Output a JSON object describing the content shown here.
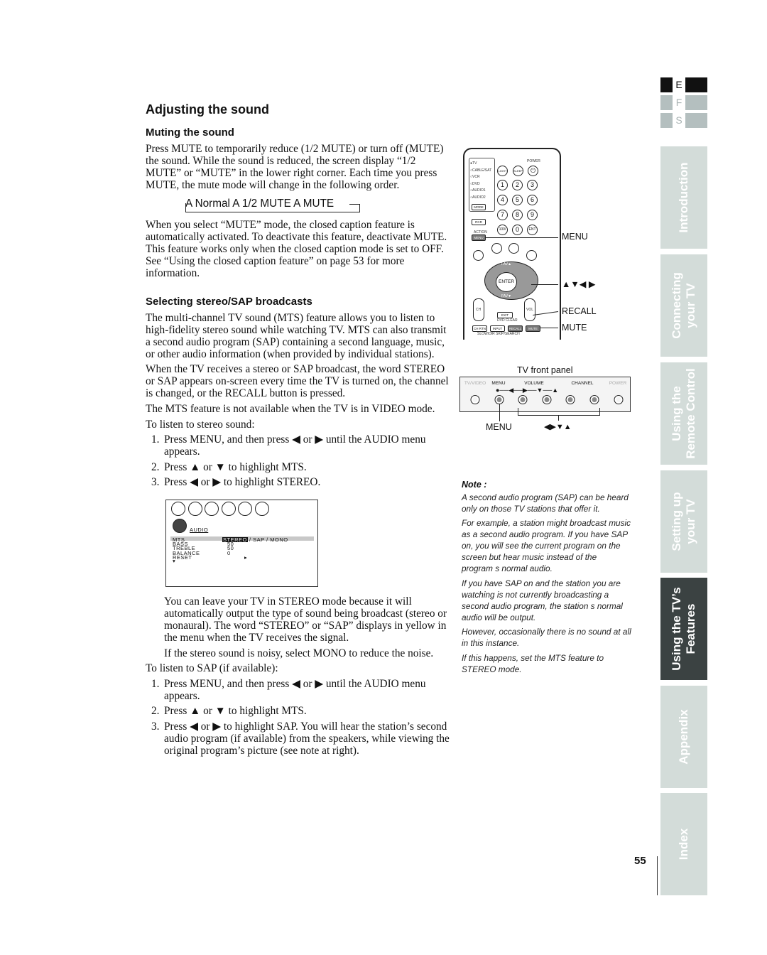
{
  "title": "Adjusting the sound",
  "muting": {
    "heading": "Muting the sound",
    "p1": [
      "Press MUTE to temporarily reduce (1/2 MUTE) or turn off (MUTE)",
      "the sound. While the sound is reduced, the screen display “1/2",
      "MUTE” or “MUTE” in the lower right corner. Each time you press",
      "MUTE, the mute mode will change in the following order."
    ],
    "sequence": "A Normal  A 1/2 MUTE  A MUTE",
    "p2": [
      "When you select “MUTE” mode, the closed caption feature is",
      "automatically activated. To deactivate this feature, deactivate MUTE.",
      "This feature works only when the closed caption mode is set to OFF.",
      "See “Using the closed caption feature” on page 53 for more",
      "information."
    ]
  },
  "stereo": {
    "heading": "Selecting stereo/SAP broadcasts",
    "p3": [
      "The multi-channel TV sound (MTS) feature allows you to listen to",
      "high-fidelity stereo sound while watching TV. MTS can also transmit",
      "a second audio program (SAP) containing a second language, music,",
      "or other audio information (when provided by individual stations)."
    ],
    "p4": [
      "When the TV receives a stereo or SAP broadcast, the word STEREO",
      "or SAP appears on-screen every time the TV is turned on, the channel",
      "is changed, or the RECALL button is pressed."
    ],
    "p5": "The MTS feature is not available when the TV is in VIDEO mode.",
    "stereo_intro": "To listen to stereo sound:",
    "stereo_steps": [
      {
        "n": "1.",
        "lines": [
          "Press MENU, and then press ◀ or ▶ until the AUDIO menu",
          "appears."
        ]
      },
      {
        "n": "2.",
        "lines": [
          "Press ▲ or ▼ to highlight MTS."
        ]
      },
      {
        "n": "3.",
        "lines": [
          "Press ◀ or ▶ to highlight STEREO."
        ]
      }
    ],
    "p6": [
      "You can leave your TV in STEREO mode because it will",
      "automatically output the type of sound being broadcast (stereo or",
      "monaural). The word “STEREO” or “SAP” displays in yellow in",
      "the menu when the TV receives the signal."
    ],
    "p7": "If the stereo sound is noisy, select MONO to reduce the noise.",
    "sap_intro": "To listen to SAP (if available):",
    "sap_steps": [
      {
        "n": "1.",
        "lines": [
          "Press MENU, and then press ◀ or ▶ until the AUDIO menu",
          "appears."
        ]
      },
      {
        "n": "2.",
        "lines": [
          "Press ▲ or ▼ to highlight MTS."
        ]
      },
      {
        "n": "3.",
        "lines": [
          "Press ◀ or ▶ to highlight SAP. You will hear the station’s second",
          "audio program (if available) from the speakers, while viewing the",
          "original program’s picture (see note at right)."
        ]
      }
    ]
  },
  "osd": {
    "menu_title": "AUDIO",
    "rows": [
      {
        "label": "MTS",
        "value": "STEREO",
        "options": "/ SAP / MONO"
      },
      {
        "label": "BASS",
        "value": "50"
      },
      {
        "label": "TREBLE",
        "value": "50"
      },
      {
        "label": "BALANCE",
        "value": "0"
      },
      {
        "label": "RESET",
        "value": "▸"
      }
    ],
    "more": "▾",
    "icons": [
      "picture-icon",
      "audio-icon",
      "setup-icon",
      "cinema-icon",
      "lock-icon",
      "option-icon"
    ]
  },
  "remote": {
    "modes": [
      "●TV",
      "○CABLE/SAT",
      "○VCR",
      "○DVD",
      "○AUDIO1",
      "○AUDIO2"
    ],
    "mode_btn": "MODE",
    "power": "POWER",
    "light": "LIGHT",
    "sleep": "SLEEP",
    "digits": [
      "1",
      "2",
      "3",
      "4",
      "5",
      "6",
      "7",
      "8",
      "9",
      "100/",
      "0",
      "ENT"
    ],
    "recall_top": "RCR",
    "action": "ACTION",
    "menu_btn": "MENU",
    "fav_up": "FAV▲",
    "fav_down": "FAV▼",
    "enter": "ENTER",
    "ch": "CH",
    "vol": "VOL",
    "exit": "EXIT",
    "dvd_clear": "DVD CLEAR",
    "bottom": [
      "CH RTN",
      "INPUT",
      "RECALL",
      "MUTE"
    ],
    "bottom_labels": "SLOW/DIR   SKIP/SEARCH",
    "callouts": {
      "menu": "MENU",
      "arrows": "▲▼◀ ▶",
      "recall": "RECALL",
      "mute": "MUTE"
    }
  },
  "front_panel": {
    "caption": "TV front panel",
    "labels": [
      "TV/VIDEO",
      "MENU",
      "VOLUME",
      "CHANNEL",
      "POWER"
    ],
    "callout_menu": "MENU",
    "callout_arrows": "◀▶▼▲"
  },
  "note": {
    "heading": "Note :",
    "paras": [
      [
        "A second audio program (SAP) can be heard",
        "only on those TV stations that offer it."
      ],
      [
        "For example, a station might broadcast music",
        "as a second audio program. If you have SAP",
        "on, you will see the current program on the",
        "screen but hear music instead of the",
        "program s normal audio."
      ],
      [
        "If you have SAP on and the station you are",
        "watching is not currently broadcasting a",
        "second audio program, the station s normal",
        "audio will be output."
      ],
      [
        "However, occasionally there is no sound at all",
        "in this instance."
      ],
      [
        "If this happens, set the MTS feature to",
        "STEREO mode."
      ]
    ]
  },
  "languages": [
    {
      "code": "E",
      "active": true
    },
    {
      "code": "F",
      "active": false
    },
    {
      "code": "S",
      "active": false
    }
  ],
  "tabs": [
    {
      "label": "Introduction",
      "active": false
    },
    {
      "label": "Connecting\nyour TV",
      "active": false
    },
    {
      "label": "Using the\nRemote Control",
      "active": false
    },
    {
      "label": "Setting up\nyour TV",
      "active": false
    },
    {
      "label": "Using the TV’s\nFeatures",
      "active": true
    },
    {
      "label": "Appendix",
      "active": false
    },
    {
      "label": "Index",
      "active": false
    }
  ],
  "page_number": "55",
  "colors": {
    "tab": "#d3dcd9",
    "tab_active": "#3b4242",
    "lang_active": "#111111",
    "lang_inactive": "#b4bfbf"
  }
}
